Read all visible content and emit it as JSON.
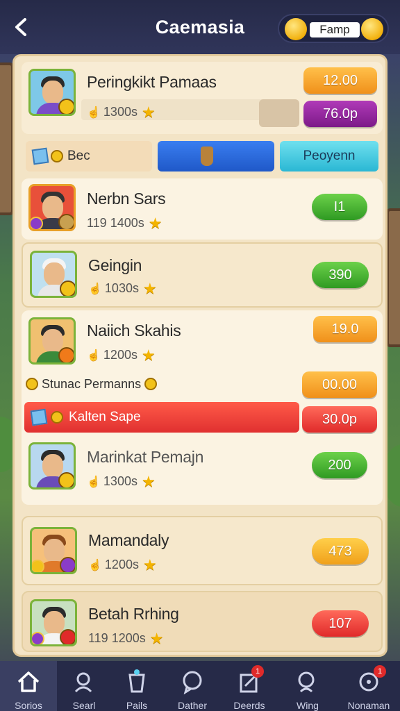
{
  "header": {
    "title": "Caemasia",
    "currency_label": "Famp"
  },
  "top_player": {
    "name": "Peringkikt Pamaas",
    "score": "1300s",
    "primary_value": "12.00",
    "secondary_value": "76.0p"
  },
  "tabs": [
    {
      "label": "Bec"
    },
    {
      "label": ""
    },
    {
      "label": "Peoyenn"
    }
  ],
  "players": [
    {
      "name": "Nerbn Sars",
      "score": "119 1400s",
      "value": "I1"
    },
    {
      "name": "Geingin",
      "score": "1030s",
      "value": "390"
    },
    {
      "name": "Naiich Skahis",
      "score": "1200s",
      "value": "19.0"
    },
    {
      "name": "Marinkat Pemajn",
      "score": "1300s",
      "value": "200"
    },
    {
      "name": "Mamandaly",
      "score": "1200s",
      "value": "473"
    },
    {
      "name": "Betah Rrhing",
      "score": "119 1200s",
      "value": "107"
    }
  ],
  "special_rows": {
    "status_label": "Stunac Permanns",
    "status_value": "00.00",
    "highlight_label": "Kalten Sape",
    "highlight_value": "30.0p"
  },
  "nav": [
    {
      "label": "Sorios",
      "icon": "home-icon"
    },
    {
      "label": "Searl",
      "icon": "user-search-icon"
    },
    {
      "label": "Pails",
      "icon": "cup-icon"
    },
    {
      "label": "Dather",
      "icon": "chat-icon"
    },
    {
      "label": "Deerds",
      "icon": "edit-icon"
    },
    {
      "label": "Wing",
      "icon": "search-icon"
    },
    {
      "label": "Nonaman",
      "icon": "target-icon"
    }
  ],
  "colors": {
    "accent_green": "#2f9a22",
    "accent_orange": "#f0901a",
    "accent_red": "#e02a2a",
    "accent_blue": "#1f58c8",
    "panel_bg": "#f3e4c6"
  }
}
